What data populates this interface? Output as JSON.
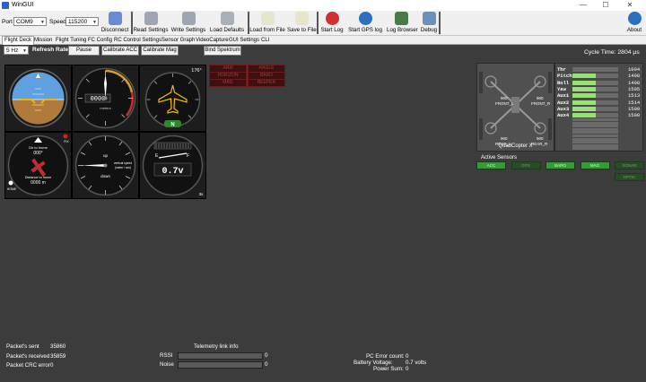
{
  "window": {
    "title": "WinGUI",
    "min": "—",
    "max": "☐",
    "close": "✕"
  },
  "toolbar": {
    "port_label": "Port",
    "port_value": "COM9",
    "speed_label": "Speed",
    "speed_value": "115200",
    "buttons": [
      {
        "label": "Disconnect",
        "icon": "satellite-icon",
        "color": "#6a8ad6"
      },
      {
        "label": "Read Settings",
        "icon": "gear-read-icon",
        "color": "#9ea6b3"
      },
      {
        "label": "Write Settings",
        "icon": "gear-write-icon",
        "color": "#9ea6b3"
      },
      {
        "label": "Load Defaults",
        "icon": "gauge-icon",
        "color": "#aab0ba"
      },
      {
        "label": "Load from File",
        "icon": "file-load-icon",
        "color": "#e8e6c8"
      },
      {
        "label": "Save to File",
        "icon": "file-save-icon",
        "color": "#e8e6c8"
      },
      {
        "label": "Start Log",
        "icon": "record-icon",
        "color": "#d03030"
      },
      {
        "label": "Start GPS log",
        "icon": "globe-icon",
        "color": "#2b6fc2"
      },
      {
        "label": "Log Browser",
        "icon": "log-browser-icon",
        "color": "#4a7a4a"
      },
      {
        "label": "Debug",
        "icon": "debug-icon",
        "color": "#6a90c0"
      },
      {
        "label": "About",
        "icon": "info-icon",
        "color": "#2b6fc2"
      }
    ]
  },
  "tabs": [
    "Flight Deck",
    "Mission",
    "Flight Tuning",
    "FC Config",
    "RC Control Settings",
    "Sensor Graph",
    "VideoCapture",
    "GUI Settings",
    "CLI"
  ],
  "controls": {
    "rate": "5 Hz",
    "refresh_rate": "Refresh Rate",
    "pause": "Pause",
    "cal_acc": "Calibrate ACC",
    "cal_mag": "Calibrate Mag",
    "bind": "Bind Spektrum"
  },
  "instruments": {
    "altimeter_label": "meters",
    "altimeter_value": "0000",
    "heading": "176°",
    "heading_dir": "N",
    "home_dir_label": "Dir to home",
    "home_dir_value": "000°",
    "home_dist_label": "Distance to home",
    "home_dist_value": "0000 m",
    "home": "HOME",
    "fix": "FIX",
    "vario_up": "up",
    "vario_down": "down",
    "vario_label": "vertical speed",
    "vario_unit": "(meter / sec)",
    "battery": "0.7v",
    "battery_cells": "3s"
  },
  "modes": [
    "ARM",
    "ANGLE",
    "HORIZON",
    "BARO",
    "MAG",
    "BEEPER"
  ],
  "cycle_time": "Cycle Time:  2804 µs",
  "quad": {
    "name": "QuadCopter X",
    "front_l": "FRONT_L",
    "front_r": "FRONT_R",
    "rear_l": "REAR_L",
    "rear_r": "REAR_R",
    "m_val": "900"
  },
  "rc": [
    {
      "name": "Thr",
      "value": "1004",
      "frac": 0.0
    },
    {
      "name": "Pitch",
      "value": "1498",
      "frac": 0.5
    },
    {
      "name": "Roll",
      "value": "1498",
      "frac": 0.5
    },
    {
      "name": "Yaw",
      "value": "1505",
      "frac": 0.5
    },
    {
      "name": "Aux1",
      "value": "1513",
      "frac": 0.51
    },
    {
      "name": "Aux2",
      "value": "1514",
      "frac": 0.51
    },
    {
      "name": "Aux3",
      "value": "1500",
      "frac": 0.5
    },
    {
      "name": "Aux4",
      "value": "1500",
      "frac": 0.5
    }
  ],
  "sensors": {
    "title": "Active Sensors",
    "items": [
      {
        "name": "ACC",
        "on": true
      },
      {
        "name": "GPS",
        "on": false
      },
      {
        "name": "BARO",
        "on": true
      },
      {
        "name": "MAG",
        "on": true
      },
      {
        "name": "SONAR",
        "on": false
      },
      {
        "name": "OPTIC",
        "on": false
      }
    ]
  },
  "stats": {
    "sent_label": "Packet's sent",
    "sent": "35860",
    "recv_label": "Packet's received",
    "recv": "35859",
    "crc_label": "Packet CRC error",
    "crc": "0",
    "telemetry": "Telemetry link info",
    "rssi_label": "RSSI",
    "rssi": "0",
    "noise_label": "Noise",
    "noise": "0",
    "pc_err_label": "PC Error count:",
    "pc_err": "0",
    "batt_label": "Battery Voltage:",
    "batt": "0.7 volts",
    "power_label": "Power Sum:",
    "power": "0"
  }
}
